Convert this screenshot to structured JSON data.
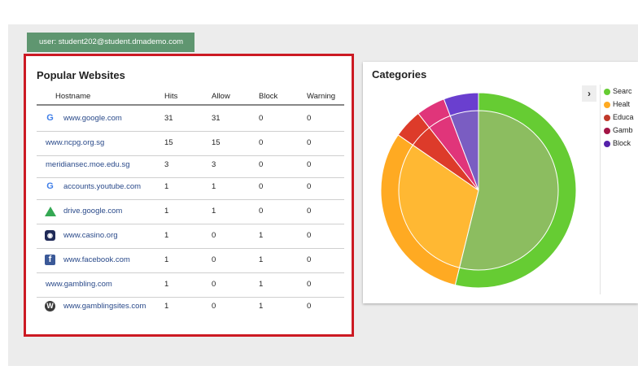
{
  "user_badge": "user: student202@student.dmademo.com",
  "popular_websites": {
    "title": "Popular Websites",
    "columns": [
      "Hostname",
      "Hits",
      "Allow",
      "Block",
      "Warning"
    ],
    "rows": [
      {
        "host": "www.google.com",
        "icon": "google-icon",
        "hits": "31",
        "allow": "31",
        "block": "0",
        "warning": "0"
      },
      {
        "host": "www.ncpg.org.sg",
        "icon": "",
        "hits": "15",
        "allow": "15",
        "block": "0",
        "warning": "0"
      },
      {
        "host": "meridiansec.moe.edu.sg",
        "icon": "",
        "hits": "3",
        "allow": "3",
        "block": "0",
        "warning": "0"
      },
      {
        "host": "accounts.youtube.com",
        "icon": "google-icon",
        "hits": "1",
        "allow": "1",
        "block": "0",
        "warning": "0"
      },
      {
        "host": "drive.google.com",
        "icon": "google-drive-icon",
        "hits": "1",
        "allow": "1",
        "block": "0",
        "warning": "0"
      },
      {
        "host": "www.casino.org",
        "icon": "casino-icon",
        "hits": "1",
        "allow": "0",
        "block": "1",
        "warning": "0"
      },
      {
        "host": "www.facebook.com",
        "icon": "facebook-icon",
        "hits": "1",
        "allow": "0",
        "block": "1",
        "warning": "0"
      },
      {
        "host": "www.gambling.com",
        "icon": "",
        "hits": "1",
        "allow": "0",
        "block": "1",
        "warning": "0"
      },
      {
        "host": "www.gamblingsites.com",
        "icon": "wordpress-icon",
        "hits": "1",
        "allow": "0",
        "block": "1",
        "warning": "0"
      }
    ]
  },
  "categories": {
    "title": "Categories",
    "legend_toggle": "›",
    "legend": [
      {
        "label": "Searc",
        "color": "#66cc33"
      },
      {
        "label": "Healt",
        "color": "#ffaa22"
      },
      {
        "label": "Educa",
        "color": "#c0392b"
      },
      {
        "label": "Gamb",
        "color": "#a31545"
      },
      {
        "label": "Block",
        "color": "#5522aa"
      }
    ]
  },
  "chart_data": {
    "type": "pie",
    "categories": [
      "Searc",
      "Healt",
      "Educa",
      "Gamb",
      "Block"
    ],
    "values": [
      56,
      32,
      5,
      5,
      6
    ],
    "colors": [
      "#66cc33",
      "#ffaa22",
      "#dd3b2a",
      "#e0357a",
      "#6a3fcf"
    ],
    "inner_colors": [
      "#8cbd60",
      "#ffb833",
      "#dd3b2a",
      "#e0357a",
      "#7a5dc2"
    ]
  }
}
